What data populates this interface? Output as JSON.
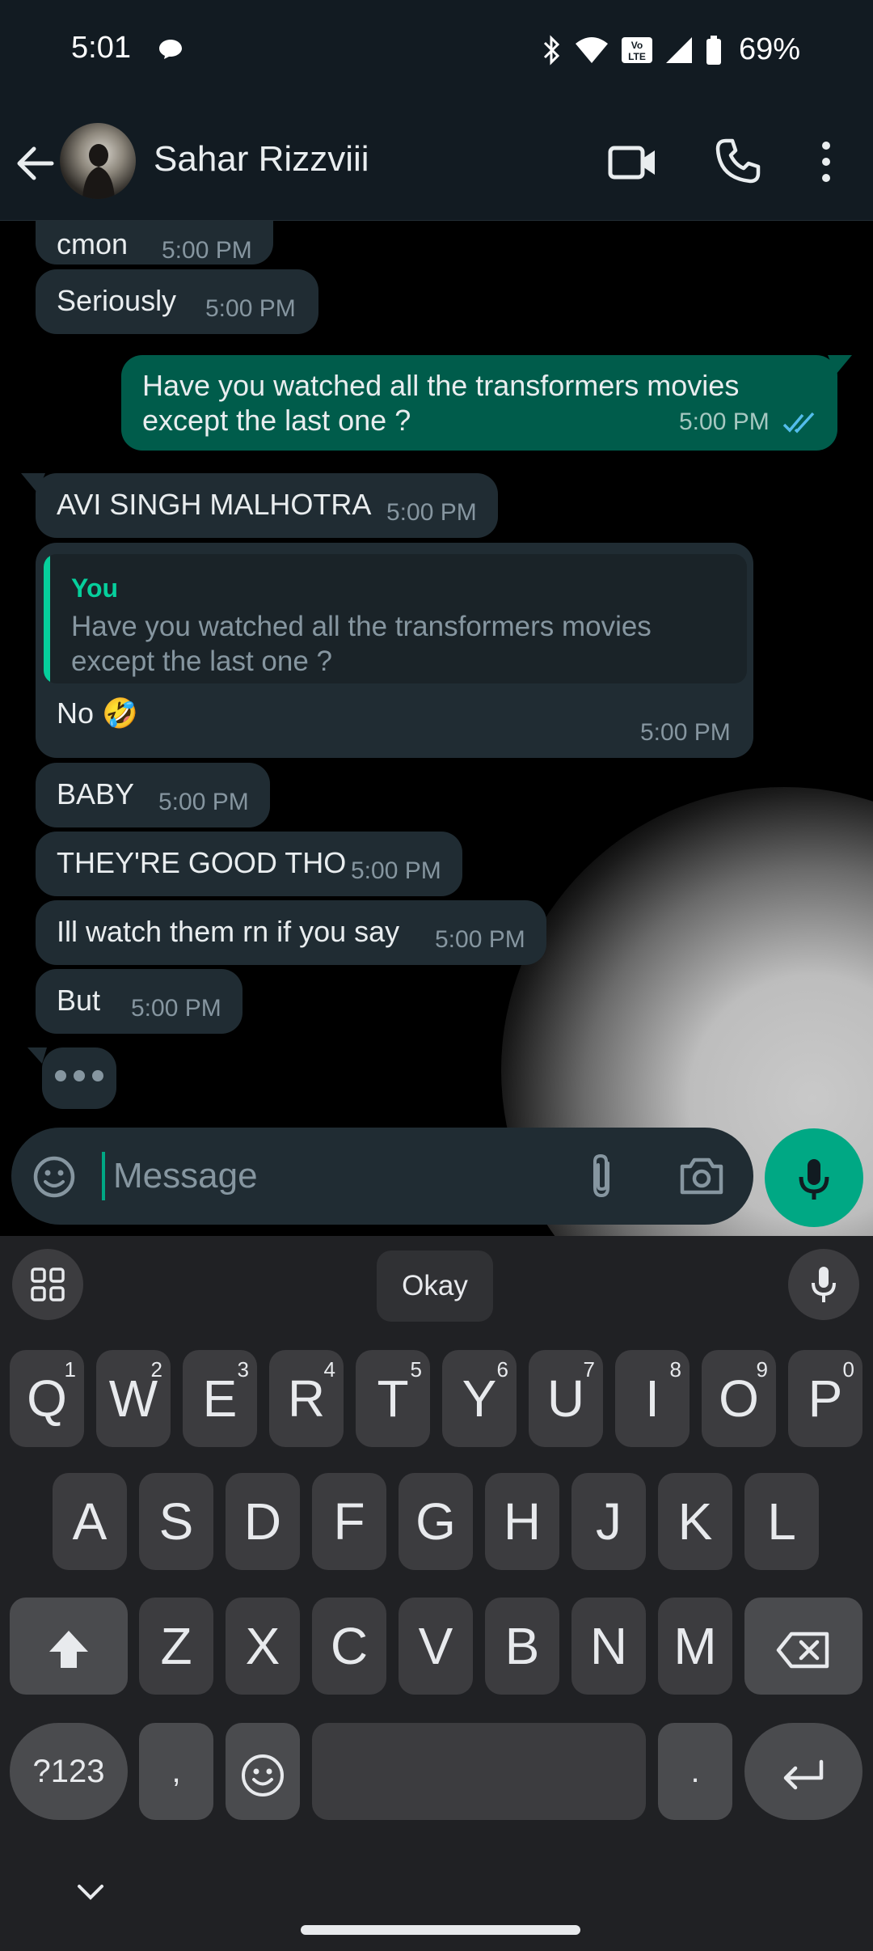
{
  "status_bar": {
    "time": "5:01",
    "battery": "69%"
  },
  "header": {
    "contact_name": "Sahar Rizzviii"
  },
  "messages": [
    {
      "text": "cmon",
      "time": "5:00 PM"
    },
    {
      "text": "Seriously",
      "time": "5:00 PM"
    },
    {
      "text": "Have you watched all the transformers movies except the last one ?",
      "time": "5:00 PM",
      "status": "read"
    },
    {
      "text": "AVI SINGH MALHOTRA",
      "time": "5:00 PM"
    },
    {
      "quote_author": "You",
      "quote_text": "Have you watched all the transformers movies except the last one ?",
      "text": "No 🤣",
      "time": "5:00 PM"
    },
    {
      "text": "BABY",
      "time": "5:00 PM"
    },
    {
      "text": "THEY'RE GOOD THO",
      "time": "5:00 PM"
    },
    {
      "text": "Ill watch them rn if you say",
      "time": "5:00 PM"
    },
    {
      "text": "But",
      "time": "5:00 PM"
    }
  ],
  "composer": {
    "placeholder": "Message"
  },
  "keyboard": {
    "suggestion": "Okay",
    "row1": [
      {
        "k": "Q",
        "n": "1"
      },
      {
        "k": "W",
        "n": "2"
      },
      {
        "k": "E",
        "n": "3"
      },
      {
        "k": "R",
        "n": "4"
      },
      {
        "k": "T",
        "n": "5"
      },
      {
        "k": "Y",
        "n": "6"
      },
      {
        "k": "U",
        "n": "7"
      },
      {
        "k": "I",
        "n": "8"
      },
      {
        "k": "O",
        "n": "9"
      },
      {
        "k": "P",
        "n": "0"
      }
    ],
    "row2": [
      "A",
      "S",
      "D",
      "F",
      "G",
      "H",
      "J",
      "K",
      "L"
    ],
    "row3": [
      "Z",
      "X",
      "C",
      "V",
      "B",
      "N",
      "M"
    ],
    "symbols_key": "?123",
    "comma_key": ",",
    "period_key": "."
  },
  "colors": {
    "outgoing": "#005c4b",
    "incoming": "#202c33",
    "accent": "#00a884"
  }
}
